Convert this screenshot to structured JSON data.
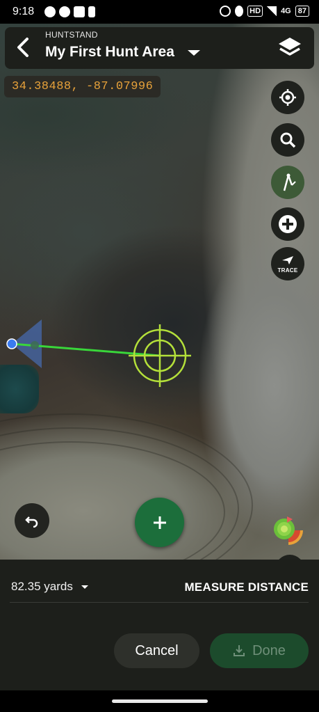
{
  "status_bar": {
    "time": "9:18",
    "network": "4G",
    "hd": "HD",
    "battery": "87"
  },
  "header": {
    "app_name": "HUNTSTAND",
    "title": "My First Hunt Area"
  },
  "map": {
    "coordinates": "34.38488, -87.07996"
  },
  "tools": {
    "trace_label": "TRACE"
  },
  "measure": {
    "distance": "82.35 yards",
    "mode_label": "MEASURE DISTANCE"
  },
  "actions": {
    "cancel": "Cancel",
    "done": "Done"
  },
  "colors": {
    "accent_green": "#1c6e3b",
    "measure_line": "#39d63a",
    "crosshair": "#b4e03a",
    "coords_text": "#e8a23a"
  }
}
